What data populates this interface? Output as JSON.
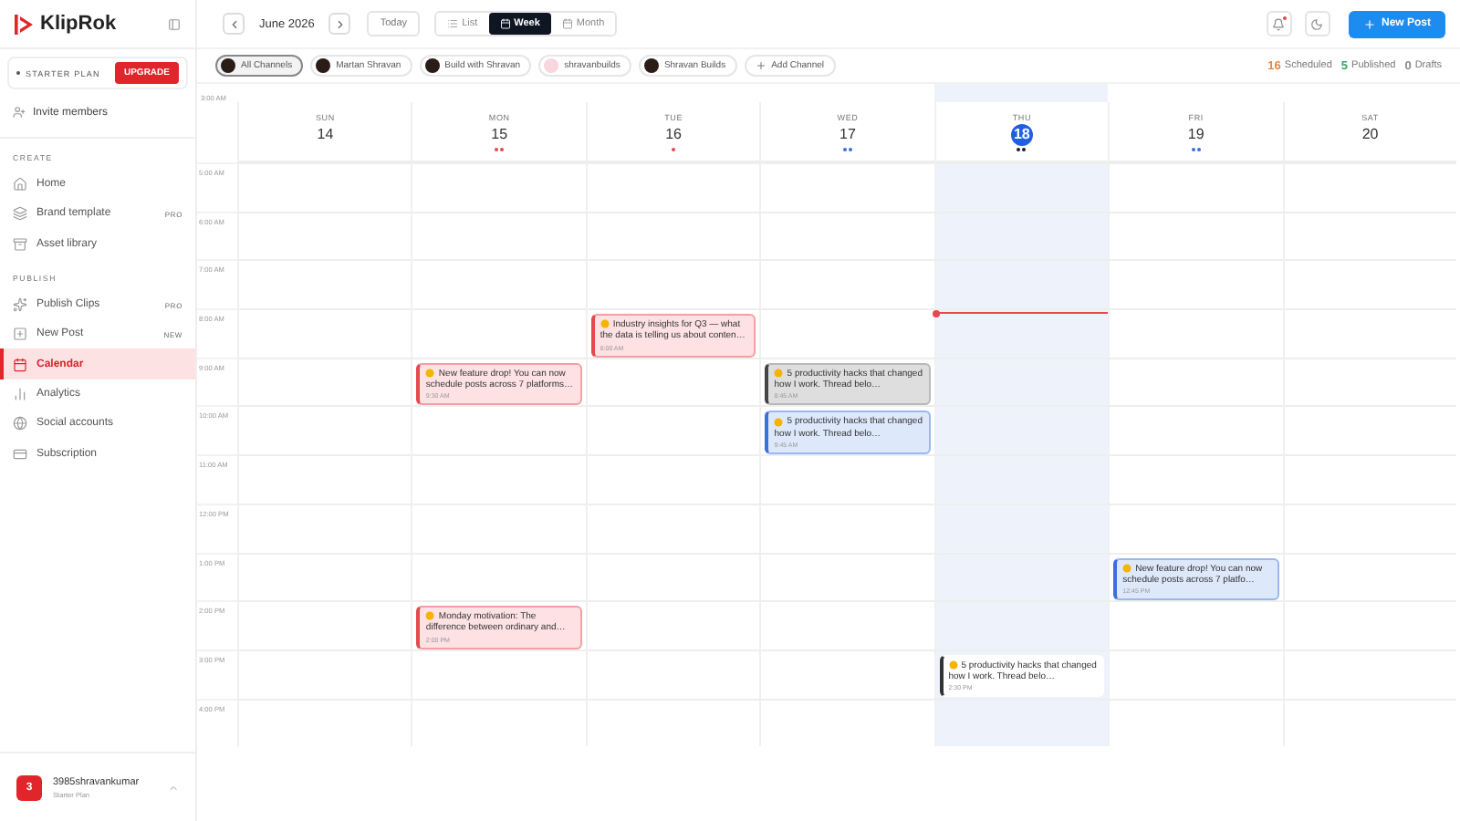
{
  "brand": {
    "name": "KlipRok"
  },
  "plan": {
    "label": "STARTER PLAN",
    "action": "UPGRADE"
  },
  "invite": "Invite members",
  "sections": [
    {
      "title": "CREATE",
      "items": [
        {
          "label": "Home",
          "selected": false
        },
        {
          "label": "Brand template",
          "badge": "PRO",
          "selected": false
        },
        {
          "label": "Asset library",
          "selected": false
        }
      ]
    },
    {
      "title": "PUBLISH",
      "items": [
        {
          "label": "Publish Clips",
          "badge": "PRO",
          "selected": false
        },
        {
          "label": "New Post",
          "badge": "NEW",
          "selected": false
        },
        {
          "label": "Calendar",
          "selected": true
        },
        {
          "label": "Analytics",
          "selected": false
        },
        {
          "label": "Social accounts",
          "selected": false
        },
        {
          "label": "Subscription",
          "selected": false
        }
      ]
    }
  ],
  "user": {
    "initial": "3",
    "name": "3985shravankumar",
    "plan": "Starter Plan"
  },
  "toolbar": {
    "month": "June 2026",
    "today": "Today",
    "views": [
      {
        "label": "List",
        "selected": false
      },
      {
        "label": "Week",
        "selected": true
      },
      {
        "label": "Month",
        "selected": false
      }
    ],
    "new_post": "New Post"
  },
  "channels": [
    {
      "label": "All Channels",
      "selected": true
    },
    {
      "label": "Martan Shravan",
      "selected": false
    },
    {
      "label": "Build with Shravan",
      "selected": false
    },
    {
      "label": "shravanbuilds",
      "selected": false
    },
    {
      "label": "Shravan Builds",
      "selected": false
    }
  ],
  "add_channel": "Add Channel",
  "stats": [
    {
      "count": "16",
      "label": "Scheduled",
      "color": "#e8833a"
    },
    {
      "count": "5",
      "label": "Published",
      "color": "#3aa863"
    },
    {
      "count": "0",
      "label": "Drafts",
      "color": "#888888"
    }
  ],
  "top_time": "3:00 AM",
  "days": [
    {
      "name": "SUN",
      "date": "14",
      "today": false
    },
    {
      "name": "MON",
      "date": "15",
      "today": false,
      "dots": [
        {
          "color": "#e5484d"
        },
        {
          "color": "#e5484d"
        }
      ]
    },
    {
      "name": "TUE",
      "date": "16",
      "today": false,
      "dots": [
        {
          "color": "#e5484d"
        }
      ]
    },
    {
      "name": "WED",
      "date": "17",
      "today": false,
      "dots": [
        {
          "color": "#3b6fd9"
        },
        {
          "color": "#3b6fd9"
        }
      ]
    },
    {
      "name": "THU",
      "date": "18",
      "today": true,
      "dots": [
        {
          "color": "#222222"
        },
        {
          "color": "#222222"
        }
      ]
    },
    {
      "name": "FRI",
      "date": "19",
      "today": false,
      "dots": [
        {
          "color": "#3b6fd9"
        },
        {
          "color": "#3b6fd9"
        }
      ]
    },
    {
      "name": "SAT",
      "date": "20",
      "today": false
    }
  ],
  "hours": [
    {
      "label": "5:00 AM"
    },
    {
      "label": "6:00 AM"
    },
    {
      "label": "7:00 AM"
    },
    {
      "label": "8:00 AM",
      "now": true,
      "cells": [
        null,
        null,
        [
          {
            "kind": "scheduled",
            "text": "Industry insights for Q3 — what the data is telling us about conten…",
            "time": "8:00 AM"
          }
        ],
        null,
        null,
        null,
        null
      ]
    },
    {
      "label": "9:00 AM",
      "cells": [
        null,
        [
          {
            "kind": "scheduled",
            "text": "New feature drop! You can now schedule posts across 7 platforms…",
            "time": "9:30 AM"
          }
        ],
        null,
        [
          {
            "kind": "draft",
            "text": "5 productivity hacks that changed how I work. Thread belo…",
            "time": "8:45 AM"
          }
        ],
        null,
        null,
        null
      ]
    },
    {
      "label": "10:00 AM",
      "cells": [
        null,
        null,
        null,
        [
          {
            "kind": "published",
            "text": "5 productivity hacks that changed how I work. Thread belo…",
            "time": "9:45 AM"
          }
        ],
        null,
        null,
        null
      ]
    },
    {
      "label": "11:00 AM"
    },
    {
      "label": "12:00 PM"
    },
    {
      "label": "1:00 PM",
      "cells": [
        null,
        null,
        null,
        null,
        null,
        [
          {
            "kind": "published",
            "text": "New feature drop! You can now schedule posts across 7 platfo…",
            "time": "12:45 PM"
          }
        ],
        null
      ]
    },
    {
      "label": "2:00 PM",
      "cells": [
        null,
        [
          {
            "kind": "scheduled",
            "text": "Monday motivation: The difference between ordinary and…",
            "time": "2:00 PM"
          }
        ],
        null,
        null,
        null,
        null,
        null
      ]
    },
    {
      "label": "3:00 PM",
      "cells": [
        null,
        null,
        null,
        null,
        [
          {
            "kind": "queued",
            "text": "5 productivity hacks that changed how I work. Thread belo…",
            "time": "2:30 PM"
          }
        ],
        null,
        null
      ]
    },
    {
      "label": "4:00 PM"
    }
  ]
}
